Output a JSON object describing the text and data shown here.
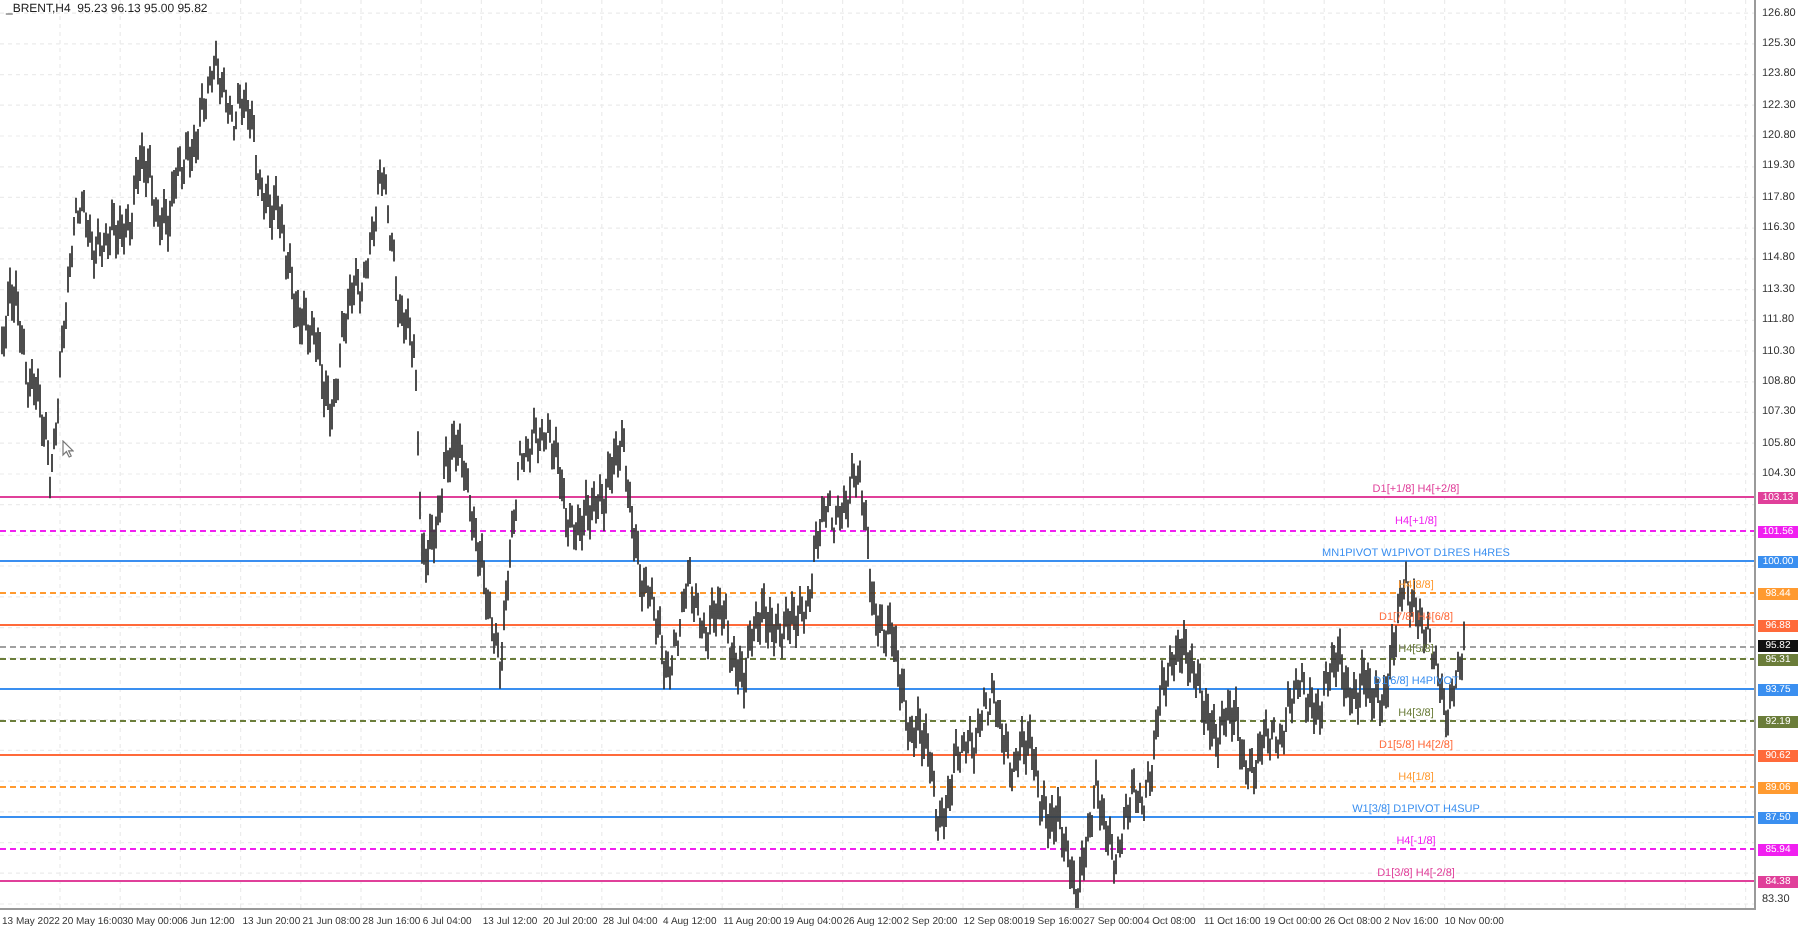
{
  "title": "_BRENT,H4  95.23 96.13 95.00 95.82",
  "price_axis": {
    "ticks": [
      "126.80",
      "125.30",
      "123.80",
      "122.30",
      "120.80",
      "119.30",
      "117.80",
      "116.30",
      "114.80",
      "113.30",
      "111.80",
      "110.30",
      "108.80",
      "107.30",
      "105.80",
      "104.30",
      "83.30"
    ]
  },
  "levels": [
    {
      "label": "D1[+1/8] H4[+2/8]",
      "price": "103.13",
      "color": "#e0409a",
      "kind": "solid"
    },
    {
      "label": "H4[+1/8]",
      "price": "101.56",
      "color": "#f020f0",
      "kind": "dashed"
    },
    {
      "label": "MN1PIVOT W1PIVOT D1RES H4RES",
      "price": "100.00",
      "color": "#3a8ff0",
      "kind": "solid"
    },
    {
      "label": "H4[8/8]",
      "price": "98.44",
      "color": "#ff9a30",
      "kind": "dashed"
    },
    {
      "label": "D1[7/8] H4[6/8]",
      "price": "96.88",
      "color": "#ff6a3a",
      "kind": "solid"
    },
    {
      "label": "H4[5/8]",
      "price": "95.31",
      "color": "#6b7d3a",
      "kind": "dashed"
    },
    {
      "label": "D1[6/8] H4PIVOT",
      "price": "93.75",
      "color": "#3a8ff0",
      "kind": "solid"
    },
    {
      "label": "H4[3/8]",
      "price": "92.19",
      "color": "#6b7d3a",
      "kind": "dashed"
    },
    {
      "label": "D1[5/8] H4[2/8]",
      "price": "90.62",
      "color": "#ff6a3a",
      "kind": "solid"
    },
    {
      "label": "H4[1/8]",
      "price": "89.06",
      "color": "#ff9a30",
      "kind": "dashed"
    },
    {
      "label": "W1[3/8] D1PIVOT H4SUP",
      "price": "87.50",
      "color": "#3a8ff0",
      "kind": "solid"
    },
    {
      "label": "H4[-1/8]",
      "price": "85.94",
      "color": "#f020f0",
      "kind": "dashed"
    },
    {
      "label": "D1[3/8] H4[-2/8]",
      "price": "84.38",
      "color": "#e0409a",
      "kind": "solid"
    }
  ],
  "current_price": {
    "price": "95.82"
  },
  "time_axis": {
    "labels": [
      "13 May 2022",
      "20 May 16:00",
      "30 May 00:00",
      "6 Jun 12:00",
      "13 Jun 20:00",
      "21 Jun 08:00",
      "28 Jun 16:00",
      "6 Jul 04:00",
      "13 Jul 12:00",
      "20 Jul 20:00",
      "28 Jul 04:00",
      "4 Aug 12:00",
      "11 Aug 20:00",
      "19 Aug 04:00",
      "26 Aug 12:00",
      "2 Sep 20:00",
      "12 Sep 08:00",
      "19 Sep 16:00",
      "27 Sep 00:00",
      "4 Oct 08:00",
      "11 Oct 16:00",
      "19 Oct 00:00",
      "26 Oct 08:00",
      "2 Nov 16:00",
      "10 Nov 00:00"
    ]
  }
}
